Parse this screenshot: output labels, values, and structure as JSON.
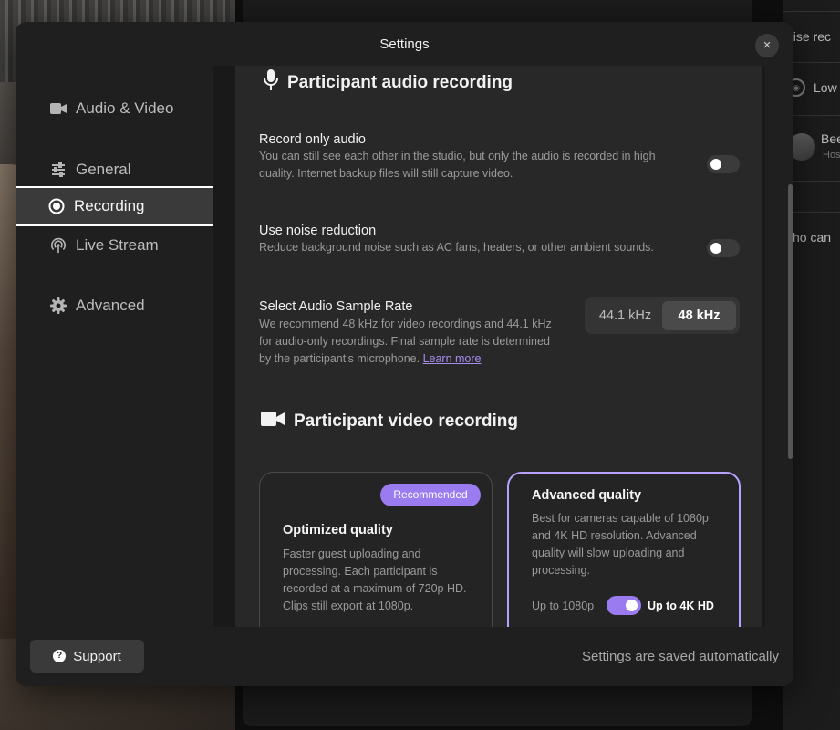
{
  "modal": {
    "title": "Settings",
    "close_icon": "×"
  },
  "sidebar": {
    "items": [
      {
        "label": "Audio & Video",
        "icon": "video-camera-icon"
      },
      {
        "label": "General",
        "icon": "sliders-icon"
      },
      {
        "label": "Recording",
        "icon": "record-icon",
        "active": true
      },
      {
        "label": "Live Stream",
        "icon": "broadcast-icon"
      },
      {
        "label": "Advanced",
        "icon": "gear-icon"
      }
    ]
  },
  "audio_section": {
    "title": "Participant audio recording",
    "record_only_audio": {
      "title": "Record only audio",
      "description": "You can still see each other in the studio, but only the audio is recorded in high quality. Internet backup files will still capture video.",
      "enabled": false
    },
    "noise_reduction": {
      "title": "Use noise reduction",
      "description": "Reduce background noise such as AC fans, heaters, or other ambient sounds.",
      "enabled": false
    },
    "sample_rate": {
      "title": "Select Audio Sample Rate",
      "description": "We recommend 48 kHz for video recordings and 44.1 kHz for audio-only recordings. Final sample rate is determined by the participant's microphone.",
      "link": "Learn more",
      "options": [
        "44.1 kHz",
        "48 kHz"
      ],
      "selected": "48 kHz"
    }
  },
  "video_section": {
    "title": "Participant video recording",
    "optimized": {
      "badge": "Recommended",
      "title": "Optimized quality",
      "description": "Faster guest uploading and processing. Each participant is recorded at a maximum of 720p HD. Clips still export at 1080p."
    },
    "advanced": {
      "title": "Advanced quality",
      "description": "Best for cameras capable of 1080p and 4K HD resolution. Advanced quality will slow uploading and processing.",
      "toggle_off_label": "Up to 1080p",
      "toggle_on_label": "Up to 4K HD",
      "toggle_on": true
    }
  },
  "footer": {
    "support_label": "Support",
    "autosave_text": "Settings are saved automatically"
  },
  "background": {
    "right_panel": {
      "line1": "oise rec",
      "line2": "Low",
      "line3_name": "Bee",
      "line3_sub": "Hos",
      "line4": "cho can"
    }
  },
  "colors": {
    "accent": "#9b7bf0",
    "accent_border": "#b7a3ff",
    "link": "#a98cf0"
  }
}
